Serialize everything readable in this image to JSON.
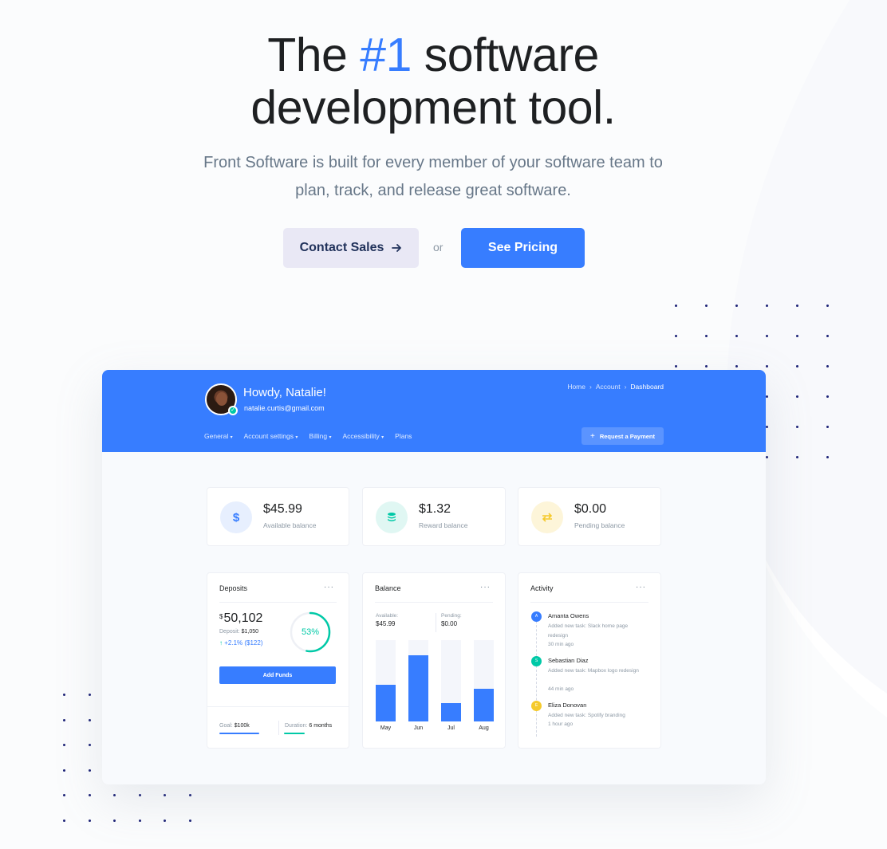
{
  "hero": {
    "title_pre": "The ",
    "title_accent": "#1",
    "title_post": " software",
    "title_line2": "development tool.",
    "subtitle_line1": "Front Software is built for every member of your software team to",
    "subtitle_line2": "plan, track, and release great software.",
    "contact_label": "Contact Sales",
    "contact_icon": "arrow-right-icon",
    "or_text": "or",
    "pricing_label": "See Pricing"
  },
  "dashboard": {
    "greeting": "Howdy, Natalie!",
    "email": "natalie.curtis@gmail.com",
    "breadcrumbs": [
      "Home",
      "Account",
      "Dashboard"
    ],
    "nav": [
      "General",
      "Account settings",
      "Billing",
      "Accessibility",
      "Plans"
    ],
    "request_label": "Request a Payment",
    "stats": [
      {
        "value": "$45.99",
        "label": "Available balance",
        "icon": "dollar-icon",
        "color": "#377dff"
      },
      {
        "value": "$1.32",
        "label": "Reward balance",
        "icon": "database-icon",
        "color": "#00c9a7"
      },
      {
        "value": "$0.00",
        "label": "Pending balance",
        "icon": "transfer-icon",
        "color": "#f5ca2c"
      }
    ],
    "deposits": {
      "title": "Deposits",
      "currency": "$",
      "amount": "50,102",
      "deposit_label": "Deposit:",
      "deposit_value": "$1,050",
      "change": "+2.1% ($122)",
      "progress": 53,
      "progress_label": "53%",
      "add_funds": "Add Funds",
      "goal_label": "Goal:",
      "goal_value": "$100k",
      "duration_label": "Duration:",
      "duration_value": "6 months"
    },
    "balance": {
      "title": "Balance",
      "available_label": "Available:",
      "available_value": "$45.99",
      "pending_label": "Pending:",
      "pending_value": "$0.00",
      "bars": [
        {
          "month": "May",
          "fill": 0.45
        },
        {
          "month": "Jun",
          "fill": 0.81
        },
        {
          "month": "Jul",
          "fill": 0.23
        },
        {
          "month": "Aug",
          "fill": 0.4
        }
      ]
    },
    "activity": {
      "title": "Activity",
      "items": [
        {
          "initial": "A",
          "name": "Amanta Owens",
          "desc": "Added new task: Slack home page redesign",
          "time": "30 min ago",
          "color": "#377dff"
        },
        {
          "initial": "S",
          "name": "Sebastian Diaz",
          "desc": "Added new task: Mapbox logo redesign",
          "time": "44 min ago",
          "color": "#00c9a7"
        },
        {
          "initial": "E",
          "name": "Eliza Donovan",
          "desc": "Added new task: Spotify branding",
          "time": "1 hour ago",
          "color": "#f5ca2c"
        }
      ]
    },
    "more_icon": "more-horizontal-icon"
  }
}
